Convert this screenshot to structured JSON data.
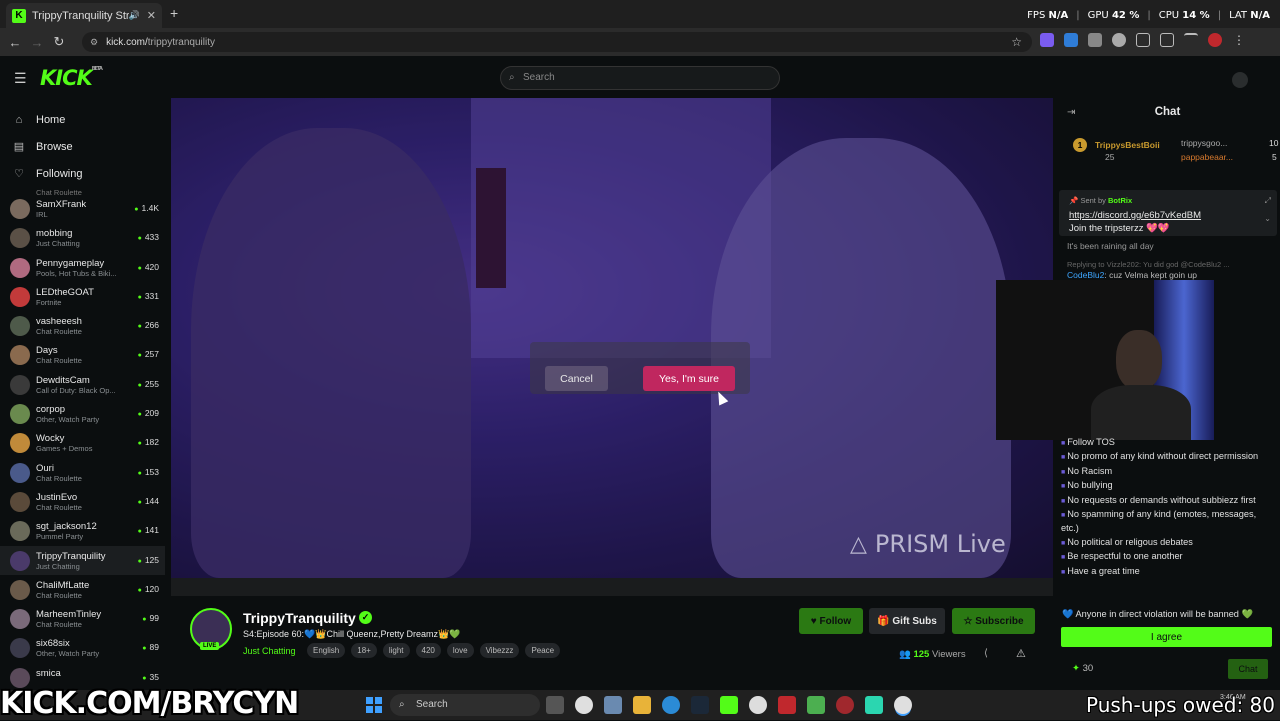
{
  "browser": {
    "tab_title": "TrippyTranquility Stream - V",
    "tab_favicon": "K",
    "url_domain": "kick.com/",
    "url_path": "trippytranquility",
    "perf": {
      "fps_label": "FPS",
      "fps_value": "N/A",
      "gpu_label": "GPU",
      "gpu_value": "42 %",
      "cpu_label": "CPU",
      "cpu_value": "14 %",
      "lat_label": "LAT",
      "lat_value": "N/A"
    }
  },
  "kick": {
    "logo": "KICK",
    "logo_badge": "BETA",
    "search_placeholder": "Search"
  },
  "sidebar": {
    "nav": [
      {
        "label": "Home",
        "icon": "home-icon"
      },
      {
        "label": "Browse",
        "icon": "browse-icon"
      },
      {
        "label": "Following",
        "icon": "heart-icon"
      }
    ],
    "partial_top": "Chat Roulette",
    "channels": [
      {
        "name": "SamXFrank",
        "category": "IRL",
        "viewers": "1.4K",
        "color": "#7a6a5e"
      },
      {
        "name": "mobbing",
        "category": "Just Chatting",
        "viewers": "433",
        "color": "#5a5046"
      },
      {
        "name": "Pennygameplay",
        "category": "Pools, Hot Tubs & Biki...",
        "viewers": "420",
        "color": "#b06a80"
      },
      {
        "name": "LEDtheGOAT",
        "category": "Fortnite",
        "viewers": "331",
        "color": "#c23a3a"
      },
      {
        "name": "vasheeesh",
        "category": "Chat Roulette",
        "viewers": "266",
        "color": "#4e5a4a"
      },
      {
        "name": "Days",
        "category": "Chat Roulette",
        "viewers": "257",
        "color": "#8a6a4e"
      },
      {
        "name": "DewditsCam",
        "category": "Call of Duty: Black Op...",
        "viewers": "255",
        "color": "#3a3a3a"
      },
      {
        "name": "corpop",
        "category": "Other, Watch Party",
        "viewers": "209",
        "color": "#6a8a4e"
      },
      {
        "name": "Wocky",
        "category": "Games + Demos",
        "viewers": "182",
        "color": "#c08a3a"
      },
      {
        "name": "Ouri",
        "category": "Chat Roulette",
        "viewers": "153",
        "color": "#4a5a8a"
      },
      {
        "name": "JustinEvo",
        "category": "Chat Roulette",
        "viewers": "144",
        "color": "#5a4a3a"
      },
      {
        "name": "sgt_jackson12",
        "category": "Pummel Party",
        "viewers": "141",
        "color": "#6a6a5a"
      },
      {
        "name": "TrippyTranquility",
        "category": "Just Chatting",
        "viewers": "125",
        "color": "#4a3a6a"
      },
      {
        "name": "ChaliMfLatte",
        "category": "Chat Roulette",
        "viewers": "120",
        "color": "#6a5a4a"
      },
      {
        "name": "MarheemTinley",
        "category": "Chat Roulette",
        "viewers": "99",
        "color": "#7a6a7a"
      },
      {
        "name": "six68six",
        "category": "Other, Watch Party",
        "viewers": "89",
        "color": "#3a3a4a"
      },
      {
        "name": "smica",
        "category": "",
        "viewers": "35",
        "color": "#5a4a5a"
      }
    ],
    "active_channel": "TrippyTranquility"
  },
  "video": {
    "watermark": "PRISM Live"
  },
  "dialog": {
    "cancel_label": "Cancel",
    "confirm_label": "Yes, I'm sure"
  },
  "stream": {
    "name": "TrippyTranquility",
    "live_badge": "LIVE",
    "title": "S4:Episode 60:💙👑Chill Queenz,Pretty Dreamz👑💚",
    "category": "Just Chatting",
    "tags": [
      "English",
      "18+",
      "light",
      "420",
      "love",
      "Vibezzz",
      "Peace"
    ],
    "follow_label": "♥ Follow",
    "gift_label": "Gift Subs",
    "subscribe_label": "Subscribe",
    "viewers": "125",
    "viewers_unit": "Viewers"
  },
  "chat": {
    "title": "Chat",
    "top_gifters": [
      {
        "rank": "1",
        "name": "TrippysBestBoii",
        "count": "25"
      },
      {
        "name": "trippysgoo...",
        "count": "10"
      },
      {
        "name": "pappabeaar...",
        "count": "5"
      }
    ],
    "pinned": {
      "sent_by_label": "Sent by",
      "sender": "BotRix",
      "link": "https://discord.gg/e6b7vKedBM",
      "after": "Join the tripsterzz 💖💖"
    },
    "msg_raining": "It's been raining all day",
    "reply_line": "Replying to Vizzle202: Yu did god @CodeBlu2 ...",
    "codeblu_name": "CodeBlu2",
    "codeblu_msg": ": cuz Velma kept goin up",
    "rules": [
      "Follow TOS",
      "No promo of any kind without direct permission",
      "No Racism",
      "No bullying",
      "No requests or demands without subbiezz first",
      "No spamming of any kind (emotes, messages, etc.)",
      "No political or religous debates",
      "Be respectful to one another",
      "Have a great time"
    ],
    "rules_footer": "💙 Anyone in direct violation will be banned 💚",
    "agree_label": "I agree",
    "points": "30",
    "send_label": "Chat"
  },
  "taskbar": {
    "search_placeholder": "Search",
    "clock": "3:46 AM"
  },
  "overlay": {
    "kick_text": "KICK.COM/BRYCYN",
    "pushups_text": "Push-ups owed: 80"
  }
}
